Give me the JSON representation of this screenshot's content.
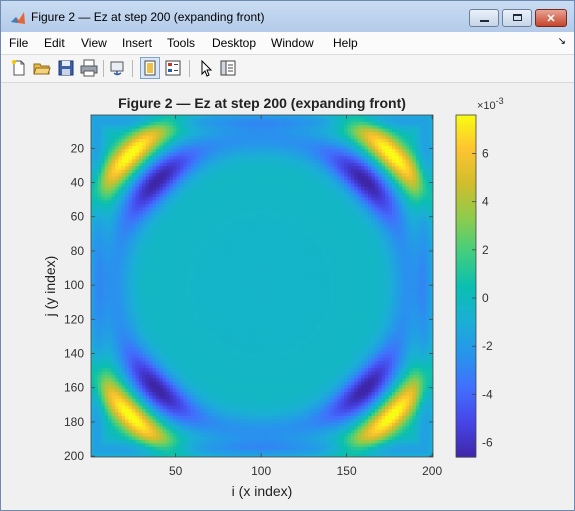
{
  "window": {
    "title": "Figure 2 — Ez at step 200 (expanding front)",
    "controls": [
      "minimize",
      "maximize",
      "close"
    ]
  },
  "menu": {
    "items": [
      "File",
      "Edit",
      "View",
      "Insert",
      "Tools",
      "Desktop",
      "Window",
      "Help"
    ],
    "overflow_icon": "dock-arrow-icon"
  },
  "toolbar": {
    "icons": [
      "new-figure-icon",
      "open-file-icon",
      "save-icon",
      "print-icon",
      "link-plot-icon",
      "hide-plot-tools-icon",
      "show-plot-tools-icon",
      "edit-plot-icon",
      "property-inspector-icon"
    ]
  },
  "chart_data": {
    "type": "heatmap",
    "title": "Figure 2 — Ez at step 200 (expanding front)",
    "xlabel": "i (x index)",
    "ylabel": "j (y index)",
    "xlim": [
      1,
      200
    ],
    "ylim": [
      1,
      200
    ],
    "y_reversed": true,
    "xticks": [
      50,
      100,
      150,
      200
    ],
    "yticks": [
      20,
      40,
      60,
      80,
      100,
      120,
      140,
      160,
      180,
      200
    ],
    "colormap": "parula",
    "colorbar": {
      "exponent_label": "×10",
      "exponent": "-3",
      "ticks": [
        -6,
        -4,
        -2,
        0,
        2,
        4,
        6
      ],
      "tick_labels": [
        "-6",
        "-4",
        "-2",
        "0",
        "2",
        "4",
        "6"
      ],
      "range": [
        -6.6,
        7.6
      ]
    },
    "grid": false
  }
}
